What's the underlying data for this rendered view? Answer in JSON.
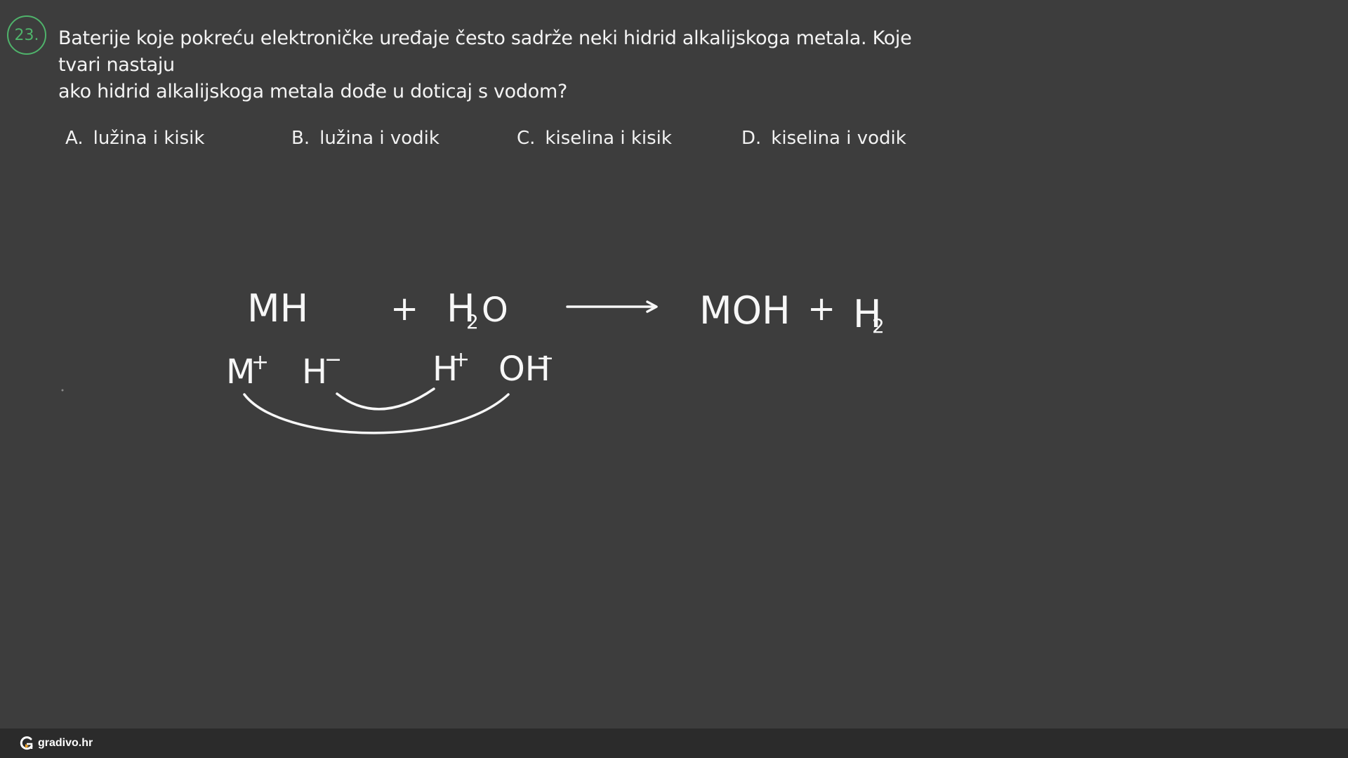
{
  "question": {
    "number": "23.",
    "text_line1": "Baterije koje pokreću elektroničke uređaje često sadrže neki hidrid alkalijskoga metala. Koje tvari nastaju",
    "text_line2": "ako hidrid alkalijskoga metala dođe u doticaj s vodom?"
  },
  "answers": [
    {
      "letter": "A.",
      "text": "lužina i kisik"
    },
    {
      "letter": "B.",
      "text": "lužina i vodik"
    },
    {
      "letter": "C.",
      "text": "kiselina i kisik"
    },
    {
      "letter": "D.",
      "text": "kiselina i vodik"
    }
  ],
  "equation": {
    "reactant1": "MH",
    "plus1": "+",
    "reactant2_main": "H",
    "reactant2_sub": "2",
    "reactant2_tail": "O",
    "product1": "MOH",
    "plus2": "+",
    "product2_main": "H",
    "product2_sub": "2"
  },
  "ions": {
    "m_cation": "M",
    "m_cation_charge": "+",
    "hydride": "H",
    "hydride_charge": "−",
    "proton": "H",
    "proton_charge": "+",
    "hydroxide": "OH",
    "hydroxide_charge": "−"
  },
  "footer": {
    "brand": "gradivo.hr"
  },
  "colors": {
    "background": "#3d3d3d",
    "accent_green": "#4fb36b",
    "ink": "#f7f7f7",
    "footer_bg": "#2b2b2b"
  }
}
